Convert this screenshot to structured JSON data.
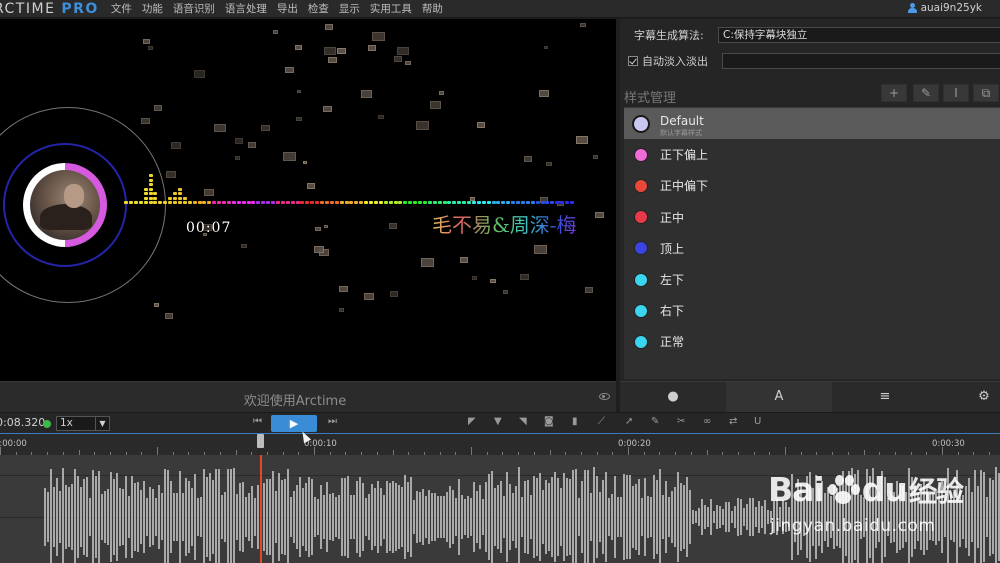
{
  "app": {
    "logo_main": "RCTIME ",
    "logo_pro": "PRO",
    "menus": [
      "文件",
      "功能",
      "语音识别",
      "语言处理",
      "导出",
      "检查",
      "显示",
      "实用工具",
      "帮助"
    ],
    "user": "auai9n25yk"
  },
  "video": {
    "timecode": "00:07",
    "lyric": "毛不易&周深-梅"
  },
  "caption_bar": {
    "welcome": "欢迎使用Arctime"
  },
  "right_panel": {
    "algorithm_label": "字幕生成算法:",
    "algorithm_value": "C:保持字幕块独立",
    "fade_label": "自动淡入淡出",
    "style_title": "样式管理",
    "styles": [
      {
        "name": "Default",
        "subtitle": "默认字幕样式",
        "color": "#c9c7f0"
      },
      {
        "name": "正下偏上",
        "color": "#f06ad8"
      },
      {
        "name": "正中偏下",
        "color": "#e8483a"
      },
      {
        "name": "正中",
        "color": "#e83a4a"
      },
      {
        "name": "顶上",
        "color": "#3a44e0"
      },
      {
        "name": "左下",
        "color": "#3ad6f0"
      },
      {
        "name": "右下",
        "color": "#3ad6f0"
      },
      {
        "name": "正常",
        "color": "#3ad6f0"
      }
    ],
    "tabs": [
      "●",
      "A",
      "≡"
    ]
  },
  "transport": {
    "time": "0:08.320",
    "speed": "1x"
  },
  "ruler": {
    "labels": [
      "0:00:00",
      "0:00:10",
      "0:00:20",
      "0:00:30"
    ]
  },
  "watermark": {
    "brand_a": "Bai",
    "brand_b": "du",
    "brand_cn": "经验",
    "url": "jingyan.baidu.com"
  }
}
